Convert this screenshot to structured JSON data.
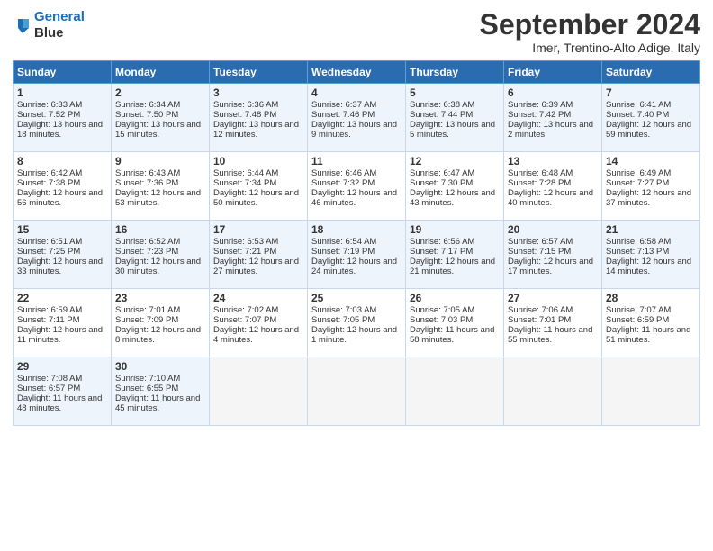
{
  "header": {
    "logo_line1": "General",
    "logo_line2": "Blue",
    "month": "September 2024",
    "location": "Imer, Trentino-Alto Adige, Italy"
  },
  "days_of_week": [
    "Sunday",
    "Monday",
    "Tuesday",
    "Wednesday",
    "Thursday",
    "Friday",
    "Saturday"
  ],
  "weeks": [
    [
      {
        "num": "1",
        "rise": "6:33 AM",
        "set": "7:52 PM",
        "hours": "13 hours and 18 minutes"
      },
      {
        "num": "2",
        "rise": "6:34 AM",
        "set": "7:50 PM",
        "hours": "13 hours and 15 minutes"
      },
      {
        "num": "3",
        "rise": "6:36 AM",
        "set": "7:48 PM",
        "hours": "13 hours and 12 minutes"
      },
      {
        "num": "4",
        "rise": "6:37 AM",
        "set": "7:46 PM",
        "hours": "13 hours and 9 minutes"
      },
      {
        "num": "5",
        "rise": "6:38 AM",
        "set": "7:44 PM",
        "hours": "13 hours and 5 minutes"
      },
      {
        "num": "6",
        "rise": "6:39 AM",
        "set": "7:42 PM",
        "hours": "13 hours and 2 minutes"
      },
      {
        "num": "7",
        "rise": "6:41 AM",
        "set": "7:40 PM",
        "hours": "12 hours and 59 minutes"
      }
    ],
    [
      {
        "num": "8",
        "rise": "6:42 AM",
        "set": "7:38 PM",
        "hours": "12 hours and 56 minutes"
      },
      {
        "num": "9",
        "rise": "6:43 AM",
        "set": "7:36 PM",
        "hours": "12 hours and 53 minutes"
      },
      {
        "num": "10",
        "rise": "6:44 AM",
        "set": "7:34 PM",
        "hours": "12 hours and 50 minutes"
      },
      {
        "num": "11",
        "rise": "6:46 AM",
        "set": "7:32 PM",
        "hours": "12 hours and 46 minutes"
      },
      {
        "num": "12",
        "rise": "6:47 AM",
        "set": "7:30 PM",
        "hours": "12 hours and 43 minutes"
      },
      {
        "num": "13",
        "rise": "6:48 AM",
        "set": "7:28 PM",
        "hours": "12 hours and 40 minutes"
      },
      {
        "num": "14",
        "rise": "6:49 AM",
        "set": "7:27 PM",
        "hours": "12 hours and 37 minutes"
      }
    ],
    [
      {
        "num": "15",
        "rise": "6:51 AM",
        "set": "7:25 PM",
        "hours": "12 hours and 33 minutes"
      },
      {
        "num": "16",
        "rise": "6:52 AM",
        "set": "7:23 PM",
        "hours": "12 hours and 30 minutes"
      },
      {
        "num": "17",
        "rise": "6:53 AM",
        "set": "7:21 PM",
        "hours": "12 hours and 27 minutes"
      },
      {
        "num": "18",
        "rise": "6:54 AM",
        "set": "7:19 PM",
        "hours": "12 hours and 24 minutes"
      },
      {
        "num": "19",
        "rise": "6:56 AM",
        "set": "7:17 PM",
        "hours": "12 hours and 21 minutes"
      },
      {
        "num": "20",
        "rise": "6:57 AM",
        "set": "7:15 PM",
        "hours": "12 hours and 17 minutes"
      },
      {
        "num": "21",
        "rise": "6:58 AM",
        "set": "7:13 PM",
        "hours": "12 hours and 14 minutes"
      }
    ],
    [
      {
        "num": "22",
        "rise": "6:59 AM",
        "set": "7:11 PM",
        "hours": "12 hours and 11 minutes"
      },
      {
        "num": "23",
        "rise": "7:01 AM",
        "set": "7:09 PM",
        "hours": "12 hours and 8 minutes"
      },
      {
        "num": "24",
        "rise": "7:02 AM",
        "set": "7:07 PM",
        "hours": "12 hours and 4 minutes"
      },
      {
        "num": "25",
        "rise": "7:03 AM",
        "set": "7:05 PM",
        "hours": "12 hours and 1 minute"
      },
      {
        "num": "26",
        "rise": "7:05 AM",
        "set": "7:03 PM",
        "hours": "11 hours and 58 minutes"
      },
      {
        "num": "27",
        "rise": "7:06 AM",
        "set": "7:01 PM",
        "hours": "11 hours and 55 minutes"
      },
      {
        "num": "28",
        "rise": "7:07 AM",
        "set": "6:59 PM",
        "hours": "11 hours and 51 minutes"
      }
    ],
    [
      {
        "num": "29",
        "rise": "7:08 AM",
        "set": "6:57 PM",
        "hours": "11 hours and 48 minutes"
      },
      {
        "num": "30",
        "rise": "7:10 AM",
        "set": "6:55 PM",
        "hours": "11 hours and 45 minutes"
      },
      null,
      null,
      null,
      null,
      null
    ]
  ]
}
